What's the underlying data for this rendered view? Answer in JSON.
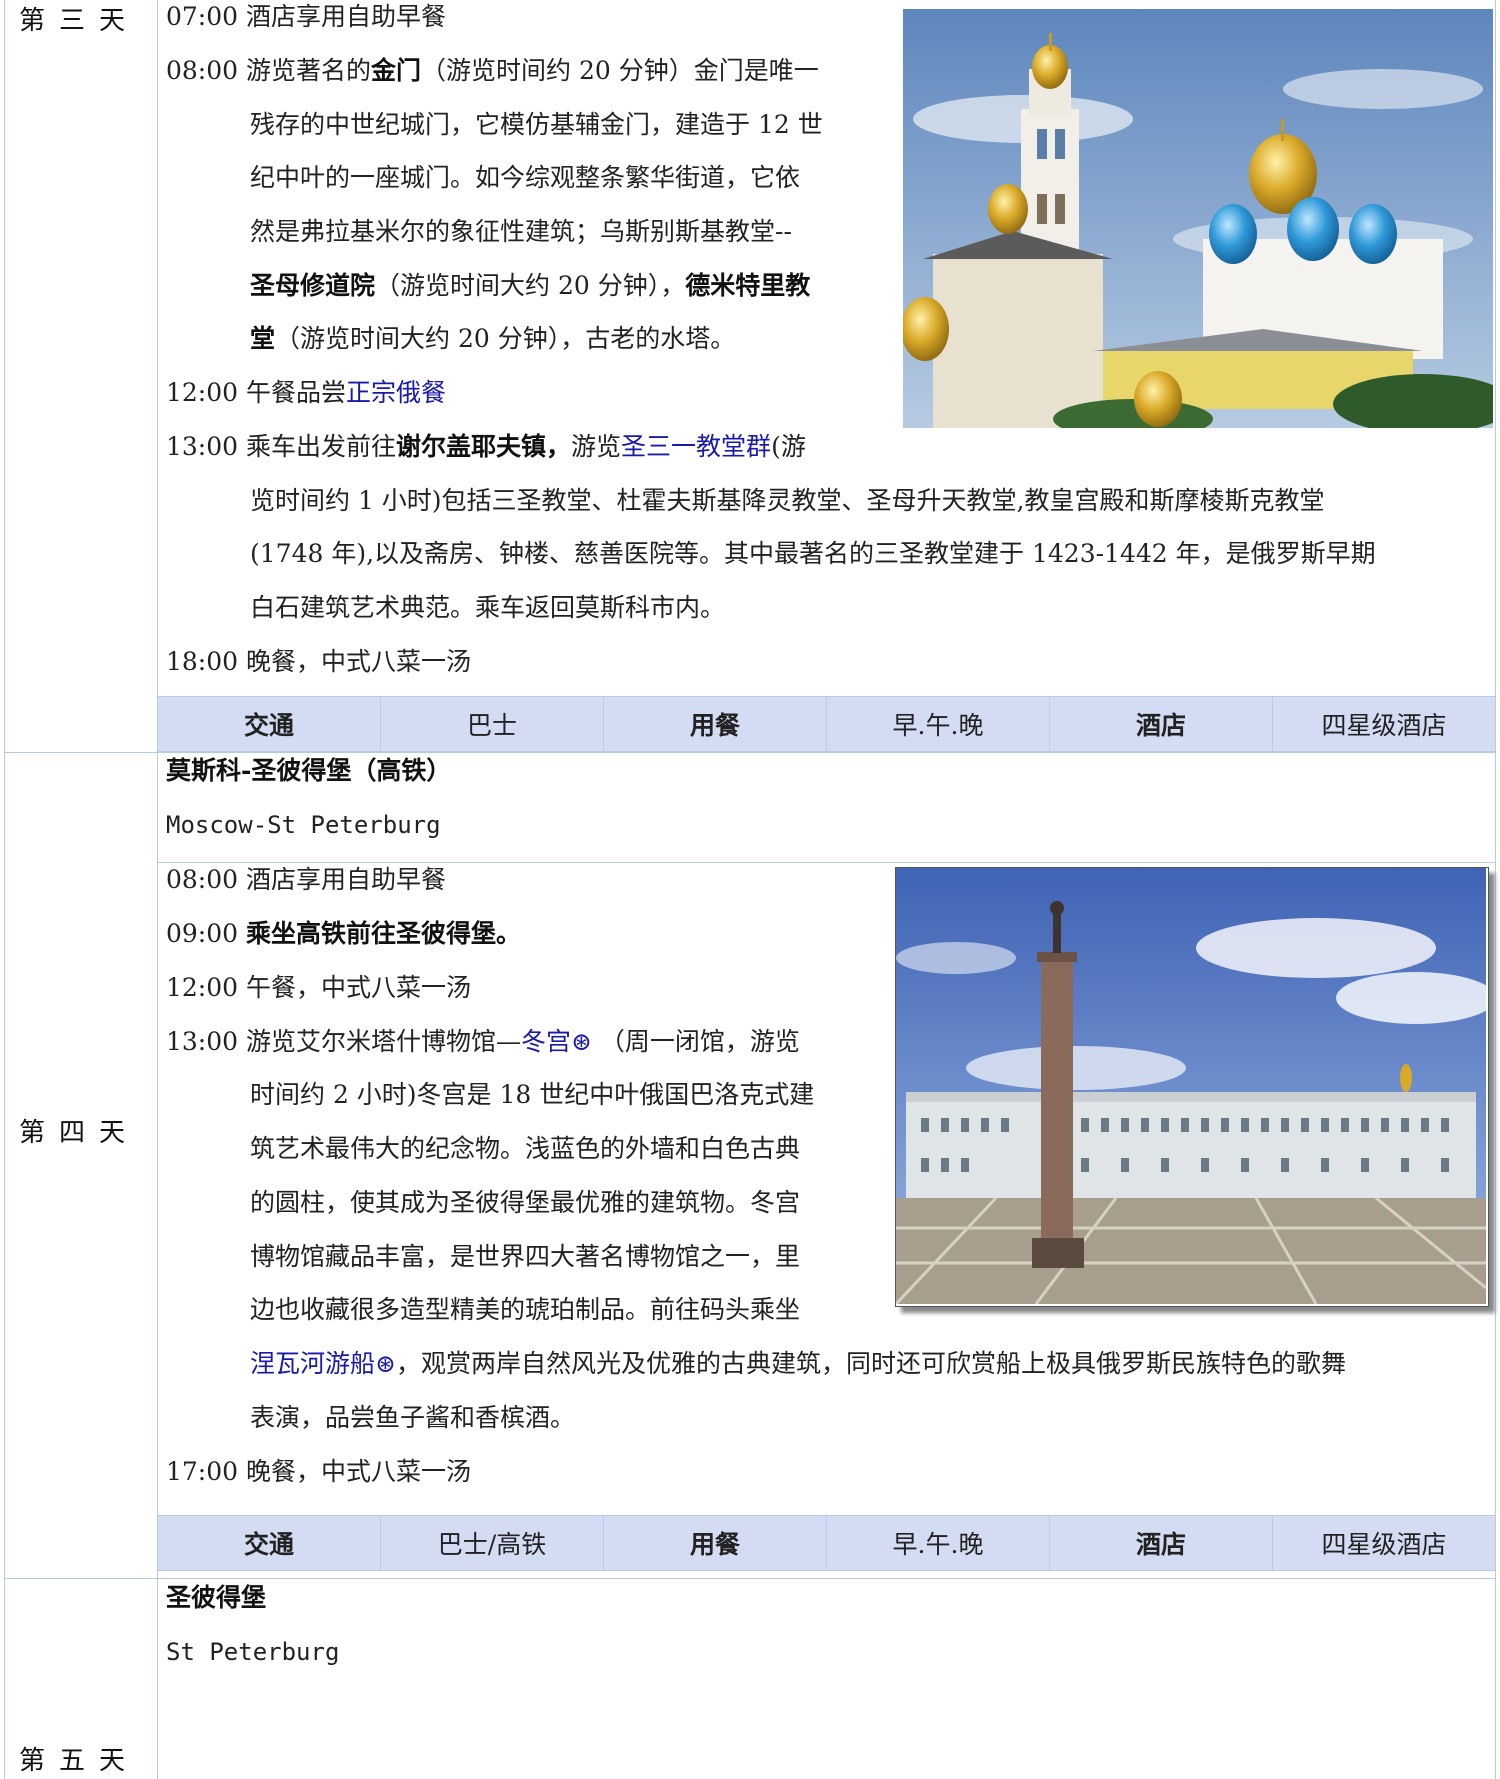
{
  "days": [
    {
      "label": "第三天",
      "lines": [
        {
          "time": "07:00",
          "parts": [
            {
              "t": "酒店享用自助早餐"
            }
          ]
        },
        {
          "time": "08:00",
          "parts": [
            {
              "t": "游览著名的"
            },
            {
              "t": "金门",
              "style": "bold"
            },
            {
              "t": "（游览时间约 20 分钟）金门是唯一"
            }
          ]
        },
        {
          "parts": [
            {
              "t": "残存的中世纪城门，它模仿基辅金门，建造于 12 世"
            }
          ]
        },
        {
          "parts": [
            {
              "t": "纪中叶的一座城门。如今综观整条繁华街道，它依"
            }
          ]
        },
        {
          "parts": [
            {
              "t": "然是弗拉基米尔的象征性建筑；乌斯别斯基教堂--"
            }
          ]
        },
        {
          "parts": [
            {
              "t": "圣母修道院",
              "style": "bold"
            },
            {
              "t": "（游览时间大约 20 分钟），"
            },
            {
              "t": "德米特里教",
              "style": "bold"
            }
          ]
        },
        {
          "parts": [
            {
              "t": "堂",
              "style": "bold"
            },
            {
              "t": "（游览时间大约 20 分钟），古老的水塔。"
            }
          ]
        },
        {
          "time": "12:00",
          "parts": [
            {
              "t": "午餐品尝"
            },
            {
              "t": "正宗俄餐",
              "style": "link"
            }
          ]
        },
        {
          "time": "13:00",
          "parts": [
            {
              "t": "乘车出发前往"
            },
            {
              "t": "谢尔盖耶夫镇，",
              "style": "bold"
            },
            {
              "t": "游览"
            },
            {
              "t": "圣三一教堂群",
              "style": "link"
            },
            {
              "t": "(游"
            }
          ]
        },
        {
          "parts": [
            {
              "t": "览时间约 1 小时)包括三圣教堂、杜霍夫斯基降灵教堂、圣母升天教堂,教皇宫殿和斯摩棱斯克教堂"
            }
          ]
        },
        {
          "parts": [
            {
              "t": "(1748 年),以及斋房、钟楼、慈善医院等。其中最著名的三圣教堂建于 1423-1442 年，是俄罗斯早期"
            }
          ]
        },
        {
          "parts": [
            {
              "t": "白石建筑艺术典范。乘车返回莫斯科市内。"
            }
          ]
        },
        {
          "time": "18:00",
          "parts": [
            {
              "t": "晚餐，中式八菜一汤"
            }
          ]
        }
      ],
      "info": [
        "交通",
        "巴士",
        "用餐",
        "早.午.晚",
        "酒店",
        "四星级酒店"
      ]
    },
    {
      "label": "第四天",
      "route_cn": "莫斯科-圣彼得堡（高铁）",
      "route_en": "Moscow-St Peterburg",
      "lines": [
        {
          "time": "08:00",
          "parts": [
            {
              "t": "酒店享用自助早餐"
            }
          ]
        },
        {
          "time": "09:00",
          "parts": [
            {
              "t": " 乘坐高铁前往圣彼得堡。",
              "style": "bold"
            }
          ]
        },
        {
          "time": "12:00",
          "parts": [
            {
              "t": "午餐，中式八菜一汤"
            }
          ]
        },
        {
          "time": "13:00",
          "parts": [
            {
              "t": "游览艾尔米塔什博物馆—"
            },
            {
              "t": "冬宫⊛",
              "style": "link"
            },
            {
              "t": "  （周一闭馆，游览"
            }
          ]
        },
        {
          "parts": [
            {
              "t": "时间约 2 小时)冬宫是 18 世纪中叶俄国巴洛克式建"
            }
          ]
        },
        {
          "parts": [
            {
              "t": "筑艺术最伟大的纪念物。浅蓝色的外墙和白色古典"
            }
          ]
        },
        {
          "parts": [
            {
              "t": "的圆柱，使其成为圣彼得堡最优雅的建筑物。冬宫"
            }
          ]
        },
        {
          "parts": [
            {
              "t": "博物馆藏品丰富，是世界四大著名博物馆之一，里"
            }
          ]
        },
        {
          "parts": [
            {
              "t": "边也收藏很多造型精美的琥珀制品。前往码头乘坐"
            }
          ]
        },
        {
          "parts": [
            {
              "t": "涅瓦河游船⊛",
              "style": "link"
            },
            {
              "t": "，观赏两岸自然风光及优雅的古典建筑，同时还可欣赏船上极具俄罗斯民族特色的歌舞"
            }
          ]
        },
        {
          "parts": [
            {
              "t": "表演，品尝鱼子酱和香槟酒。"
            }
          ]
        },
        {
          "time": "17:00",
          "parts": [
            {
              "t": "晚餐，中式八菜一汤"
            }
          ]
        }
      ],
      "info": [
        "交通",
        "巴士/高铁",
        "用餐",
        "早.午.晚",
        "酒店",
        "四星级酒店"
      ]
    },
    {
      "label": "第五天",
      "route_cn": "圣彼得堡",
      "route_en": "St Peterburg"
    }
  ],
  "colors": {
    "link": "#1a1aa8",
    "infobar": "#d3dcf2",
    "border": "#b8c9e0"
  }
}
